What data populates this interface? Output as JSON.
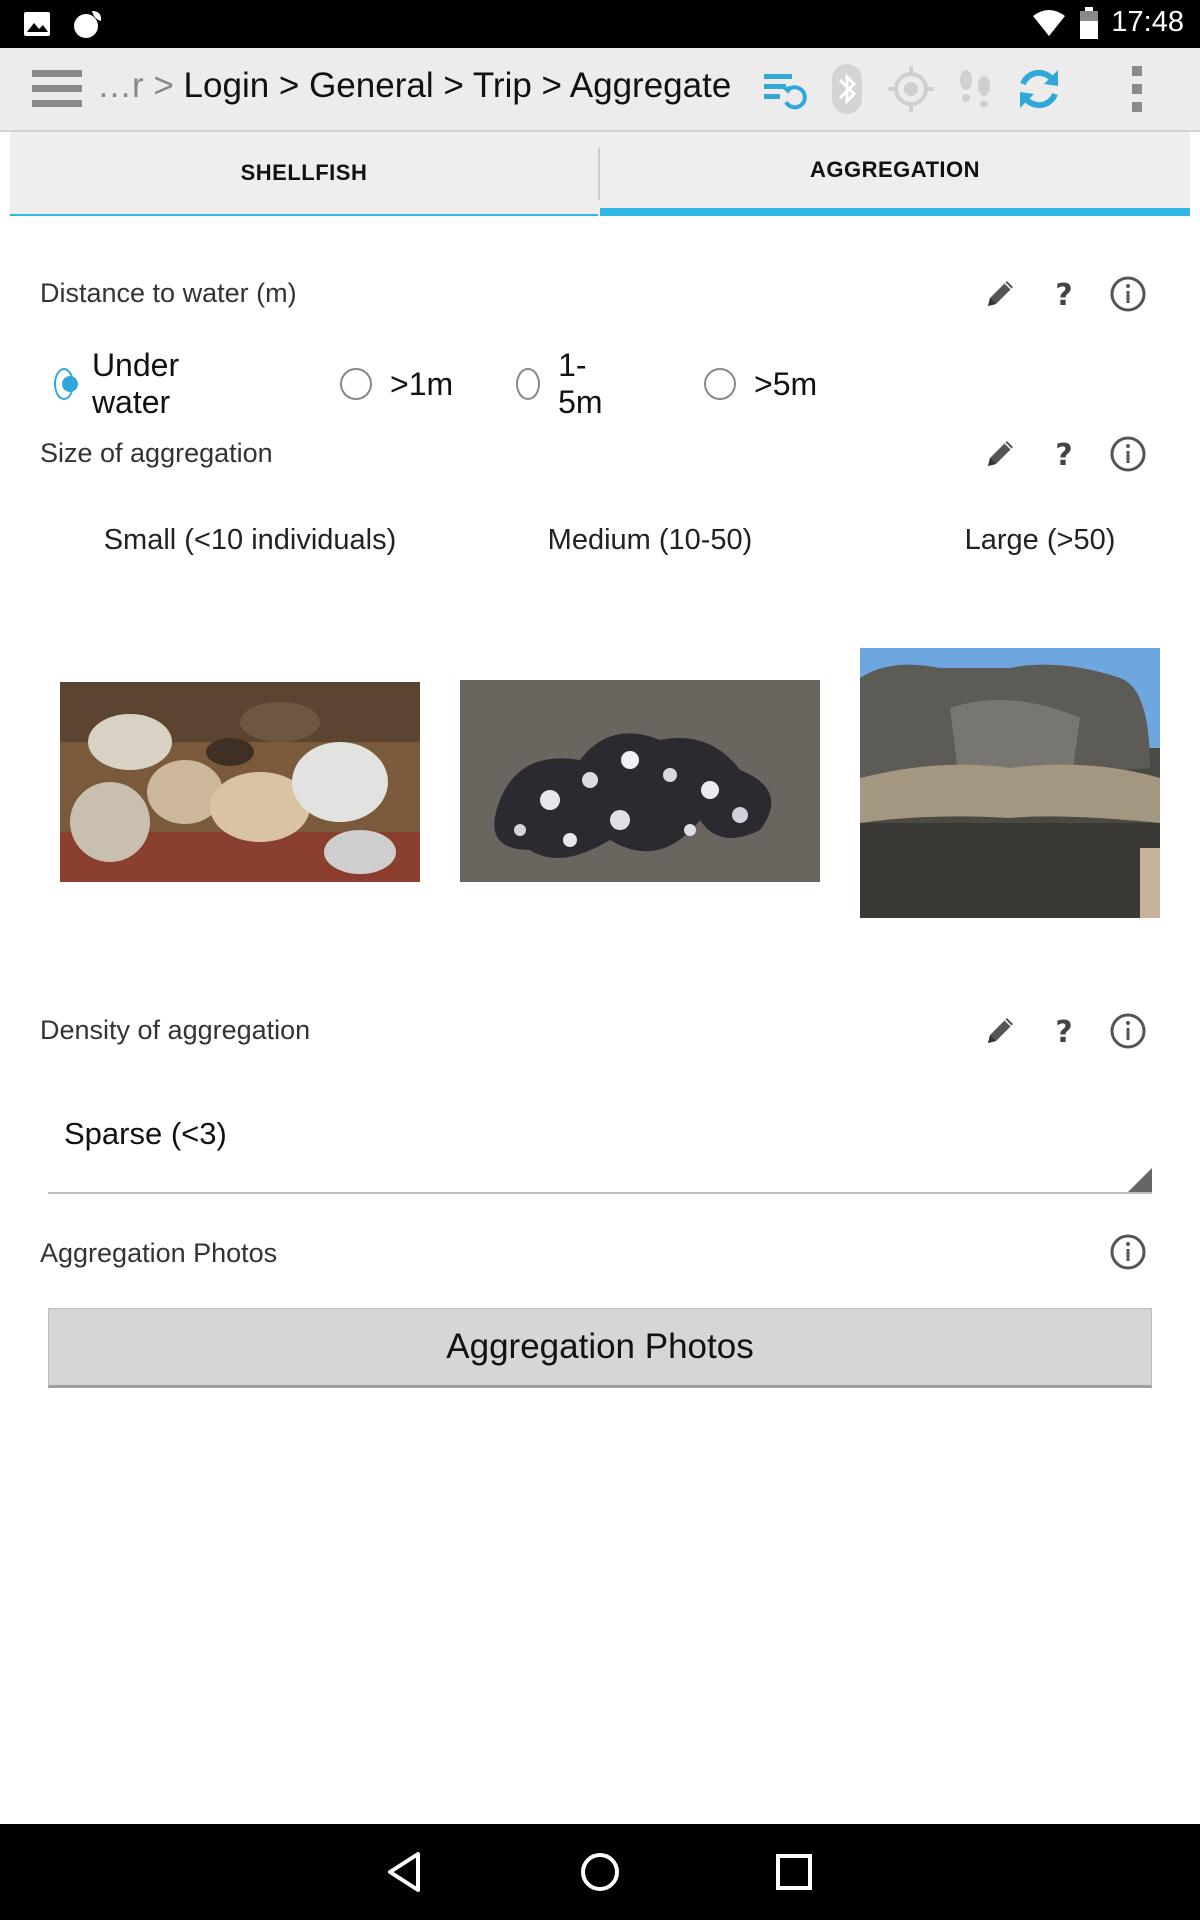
{
  "status_bar": {
    "time": "17:48",
    "icons": [
      "image-icon",
      "app-notify-icon",
      "wifi-icon",
      "battery-icon"
    ]
  },
  "toolbar": {
    "breadcrumb_prefix": "…r > ",
    "breadcrumb": "Login > General > Trip > Aggregate",
    "icons": [
      "menu-icon",
      "sync-list-icon",
      "bluetooth-icon",
      "gps-icon",
      "track-footsteps-icon",
      "refresh-icon",
      "overflow-menu-icon"
    ],
    "accent": "#33b5e5"
  },
  "tabs": [
    {
      "label": "SHELLFISH",
      "selected": false
    },
    {
      "label": "AGGREGATION",
      "selected": true
    }
  ],
  "distance": {
    "label": "Distance to water (m)",
    "options": [
      {
        "label": "Under water",
        "selected": true
      },
      {
        "label": ">1m",
        "selected": false
      },
      {
        "label": "1-5m",
        "selected": false
      },
      {
        "label": ">5m",
        "selected": false
      }
    ]
  },
  "size": {
    "label": "Size of aggregation",
    "options": [
      {
        "label": "Small (<10 individuals)"
      },
      {
        "label": "Medium (10-50)"
      },
      {
        "label": "Large (>50)"
      }
    ]
  },
  "density": {
    "label": "Density of aggregation",
    "value": "Sparse (<3)"
  },
  "photos": {
    "label": "Aggregation Photos",
    "button_label": "Aggregation Photos"
  }
}
